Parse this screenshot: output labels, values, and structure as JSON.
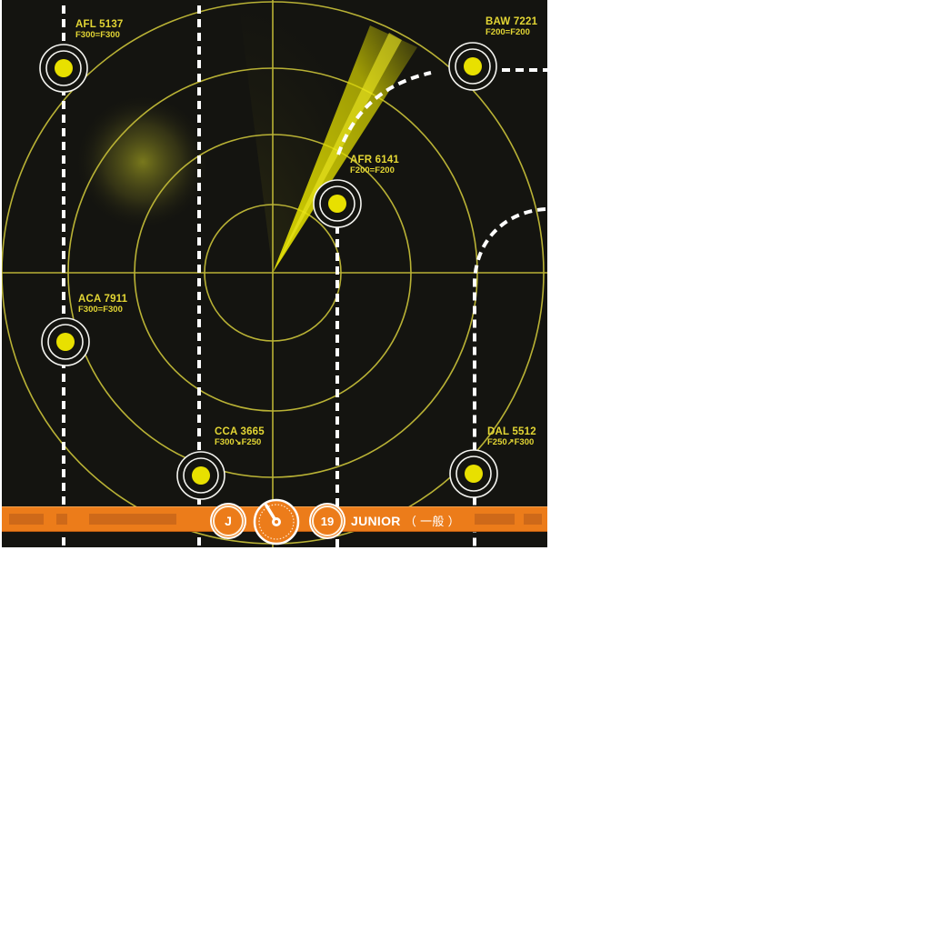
{
  "radar": {
    "colors": {
      "background": "#141410",
      "grid": "#b9b235",
      "beacon": "#e8e000",
      "beacon_ring": "#f4f4f0",
      "route": "#ffffff",
      "sweep": "#e3e000",
      "label": "#e3d634"
    },
    "flights": [
      {
        "callsign": "AFL 5137",
        "altitude": "F300=F300"
      },
      {
        "callsign": "BAW 7221",
        "altitude": "F200=F200"
      },
      {
        "callsign": "AFR 6141",
        "altitude": "F200=F200"
      },
      {
        "callsign": "ACA 7911",
        "altitude": "F300=F300"
      },
      {
        "callsign": "CCA 3665",
        "altitude": "F300↘F250"
      },
      {
        "callsign": "DAL 5512",
        "altitude": "F250↗F300"
      }
    ]
  },
  "footer": {
    "level_badge": "J",
    "icon": "speed-gauge-icon",
    "puzzle_number": "19",
    "level_name": "JUNIOR",
    "level_name_jp": "（ 一般 ）",
    "accent_color": "#ec7c1a"
  }
}
